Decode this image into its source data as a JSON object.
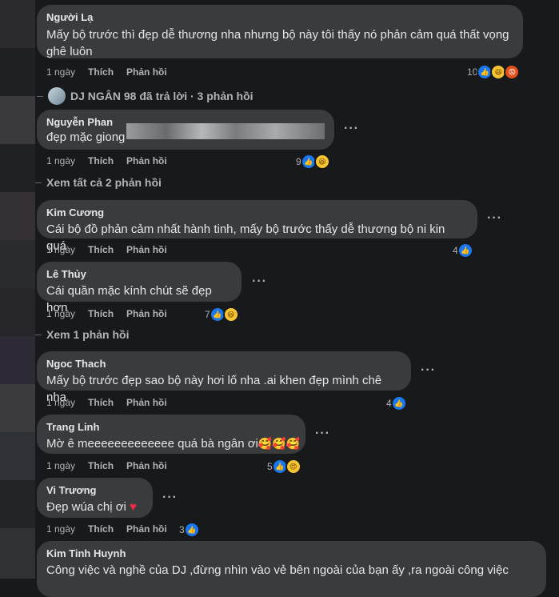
{
  "colors": {
    "bg": "#18191a",
    "bubble": "#3a3b3c",
    "like": "#1877f2"
  },
  "c1": {
    "name": "Người Lạ",
    "text1": "Mấy bộ trước thì đẹp dễ thương nha nhưng bộ này tôi thấy nó phản cảm quá thất vọng",
    "text2": "ghê luôn",
    "time": "1 ngày",
    "like": "Thích",
    "reply": "Phản hồi",
    "count": "10"
  },
  "t1": {
    "label": "DJ NGÂN 98 đã trả lời · 3 phản hồi"
  },
  "c2": {
    "name": "Nguyễn Phan",
    "text": "đẹp mặc giong",
    "time": "1 ngày",
    "like": "Thích",
    "reply": "Phản hồi",
    "count": "9"
  },
  "t2": {
    "label": "Xem tất cả 2 phản hồi"
  },
  "c3": {
    "name": "Kim Cương",
    "text": "Cái bộ đồ phản cảm nhất hành tinh, mấy bộ trước thấy dễ thương bộ ni kin quá",
    "time": "1 ngày",
    "like": "Thích",
    "reply": "Phản hồi",
    "count": "4"
  },
  "c4": {
    "name": "Lê Thủy",
    "text": "Cái quần mặc kính chút sẽ đẹp hơn",
    "time": "1 ngày",
    "like": "Thích",
    "reply": "Phản hồi",
    "count": "7"
  },
  "t3": {
    "label": "Xem 1 phản hồi"
  },
  "c5": {
    "name": "Ngoc Thach",
    "text": "Mấy bộ trước đẹp sao bộ này hơi lố nha .ai khen đẹp mình chê nha",
    "time": "1 ngày",
    "like": "Thích",
    "reply": "Phản hồi",
    "count": "4"
  },
  "c6": {
    "name": "Trang Linh",
    "text": "Mờ ê meeeeeeeeeeeee quá bà ngân ơi",
    "emoji": "🥰🥰🥰",
    "time": "1 ngày",
    "like": "Thích",
    "reply": "Phản hồi",
    "count": "5"
  },
  "c7": {
    "name": "Vi Trương",
    "text": "Đẹp wúa chị ơi",
    "emoji": "♥",
    "time": "1 ngày",
    "like": "Thích",
    "reply": "Phản hồi",
    "count": "3"
  },
  "c8": {
    "name": "Kim Tinh Huynh",
    "text": "Công việc và nghề của DJ ,đừng nhìn vào vẻ bên ngoài của bạn ấy ,ra ngoài công việc"
  },
  "icons": {
    "like": "👍",
    "haha": "😆",
    "angry": "😡",
    "love": "😍",
    "more": "···"
  }
}
